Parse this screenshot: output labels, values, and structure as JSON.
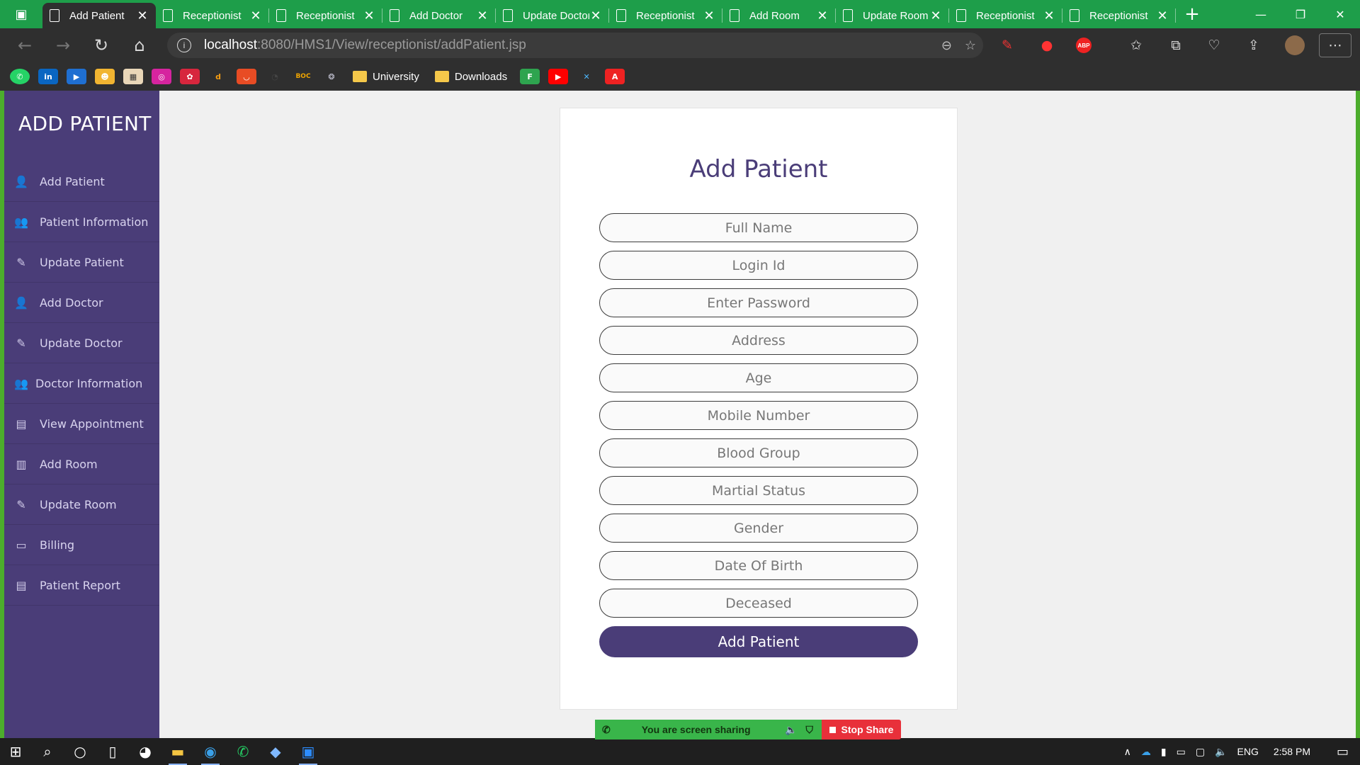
{
  "browser": {
    "tabs": [
      {
        "title": "Add Patient",
        "active": true
      },
      {
        "title": "Receptionist",
        "active": false
      },
      {
        "title": "Receptionist",
        "active": false
      },
      {
        "title": "Add Doctor",
        "active": false
      },
      {
        "title": "Update Doctor",
        "active": false
      },
      {
        "title": "Receptionist",
        "active": false
      },
      {
        "title": "Add Room",
        "active": false
      },
      {
        "title": "Update Room",
        "active": false
      },
      {
        "title": "Receptionist",
        "active": false
      },
      {
        "title": "Receptionist",
        "active": false
      }
    ],
    "url_host": "localhost",
    "url_rest": ":8080/HMS1/View/receptionist/addPatient.jsp",
    "bookmarks": {
      "folder1": "University",
      "folder2": "Downloads",
      "boc_label": "BOC",
      "abp_label": "ABP"
    }
  },
  "sidebar": {
    "brand": "ADD PATIENT",
    "items": [
      {
        "label": "Add Patient",
        "icon": "user-plus-icon"
      },
      {
        "label": "Patient Information",
        "icon": "users-icon"
      },
      {
        "label": "Update Patient",
        "icon": "pencil-icon"
      },
      {
        "label": "Add Doctor",
        "icon": "user-doctor-icon"
      },
      {
        "label": "Update Doctor",
        "icon": "pencil-icon"
      },
      {
        "label": "Doctor Information",
        "icon": "users-icon"
      },
      {
        "label": "View Appointment",
        "icon": "document-icon"
      },
      {
        "label": "Add Room",
        "icon": "building-icon"
      },
      {
        "label": "Update Room",
        "icon": "pencil-icon"
      },
      {
        "label": "Billing",
        "icon": "money-icon"
      },
      {
        "label": "Patient Report",
        "icon": "document-icon"
      }
    ]
  },
  "form": {
    "title": "Add Patient",
    "fields": {
      "full_name": "Full Name",
      "login_id": "Login Id",
      "password": "Enter Password",
      "address": "Address",
      "age": "Age",
      "mobile": "Mobile Number",
      "blood_group": "Blood Group",
      "marital_status": "Martial Status",
      "gender": "Gender",
      "dob": "Date Of Birth",
      "deceased": "Deceased"
    },
    "submit_label": "Add Patient"
  },
  "screen_share": {
    "status": "You are screen sharing",
    "stop": "Stop Share"
  },
  "taskbar": {
    "language": "ENG",
    "time": "2:58 PM"
  },
  "colors": {
    "sidebar": "#4a3d78",
    "accent": "#4a3d78",
    "tab_bar": "#1e9e4a",
    "share_green": "#39b54a",
    "share_red": "#e8303a"
  }
}
